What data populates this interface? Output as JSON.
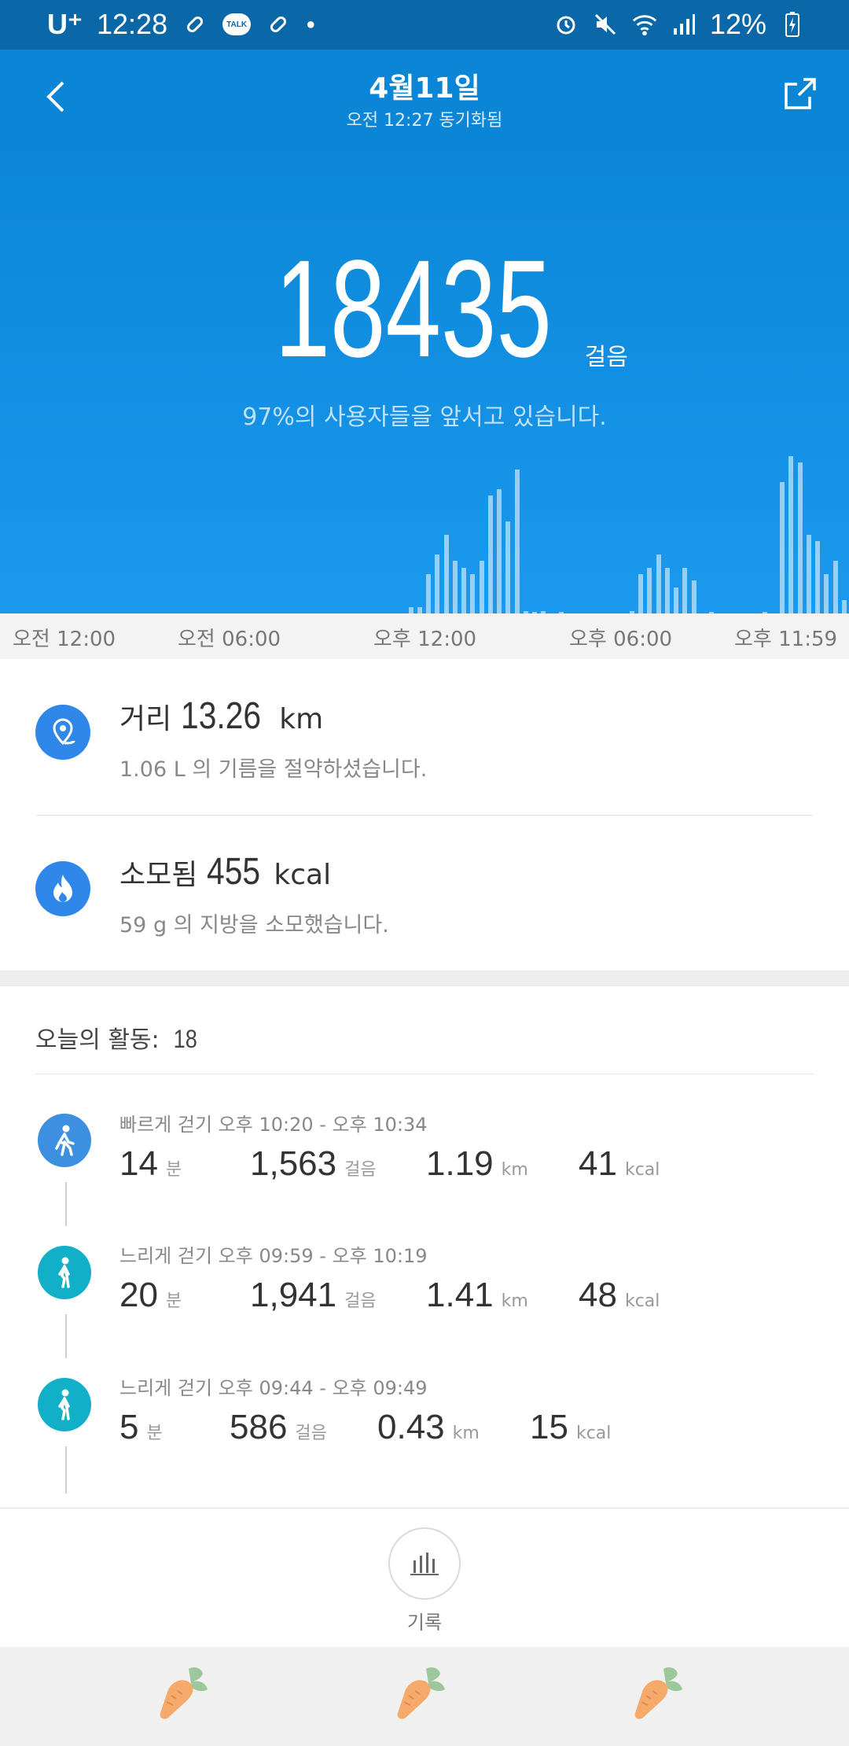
{
  "status_bar": {
    "carrier": "U⁺",
    "time": "12:28",
    "talk_badge": "TALK",
    "battery": "12%"
  },
  "header": {
    "title": "4월11일",
    "subtitle": "오전 12:27 동기화됨"
  },
  "summary": {
    "steps": "18435",
    "steps_unit": "걸음",
    "percentile_text": "97%의 사용자들을 앞서고 있습니다."
  },
  "chart_data": {
    "type": "bar",
    "x_ticks": [
      "오전 12:00",
      "오전 06:00",
      "오후 12:00",
      "오후 06:00",
      "오후 11:59"
    ],
    "bins_per_day": 96,
    "values": [
      0,
      0,
      0,
      0,
      0,
      0,
      0,
      0,
      0,
      0,
      0,
      0,
      0,
      0,
      0,
      0,
      0,
      0,
      0,
      0,
      0,
      0,
      0,
      0,
      0,
      0,
      0,
      0,
      0,
      0,
      0,
      0,
      0,
      0,
      0,
      0,
      0,
      0,
      0,
      0,
      0,
      0,
      0,
      0,
      0,
      0,
      5,
      5,
      30,
      45,
      60,
      40,
      35,
      30,
      40,
      90,
      95,
      70,
      110,
      2,
      1,
      2,
      0,
      1,
      0,
      0,
      0,
      0,
      0,
      0,
      0,
      2,
      30,
      35,
      45,
      35,
      20,
      35,
      25,
      0,
      1,
      0,
      0,
      0,
      0,
      0,
      1,
      0,
      100,
      120,
      115,
      60,
      55,
      30,
      40,
      10,
      60,
      85,
      115,
      120,
      60,
      1,
      1,
      1
    ],
    "color": "rgba(255,255,255,0.55)"
  },
  "metrics": {
    "distance": {
      "icon": "location-pin-icon",
      "label": "거리",
      "value": "13.26",
      "unit": "km",
      "note": "1.06 L 의 기름을 절약하셨습니다."
    },
    "calories": {
      "icon": "flame-icon",
      "label": "소모됨",
      "value": "455",
      "unit": "kcal",
      "note": "59 g 의 지방을 소모했습니다."
    }
  },
  "activity": {
    "title": "오늘의 활동:",
    "count": "18",
    "items": [
      {
        "type": "fast-walk",
        "label": "빠르게 걷기 오후 10:20 - 오후 10:34",
        "minutes": "14",
        "minutes_unit": "분",
        "steps": "1,563",
        "steps_unit": "걸음",
        "distance": "1.19",
        "distance_unit": "km",
        "kcal": "41",
        "kcal_unit": "kcal",
        "color": "#3d8fe0"
      },
      {
        "type": "slow-walk",
        "label": "느리게 걷기 오후 09:59 - 오후 10:19",
        "minutes": "20",
        "minutes_unit": "분",
        "steps": "1,941",
        "steps_unit": "걸음",
        "distance": "1.41",
        "distance_unit": "km",
        "kcal": "48",
        "kcal_unit": "kcal",
        "color": "#12b0c8"
      },
      {
        "type": "slow-walk",
        "label": "느리게 걷기 오후 09:44 - 오후 09:49",
        "minutes": "5",
        "minutes_unit": "분",
        "steps": "586",
        "steps_unit": "걸음",
        "distance": "0.43",
        "distance_unit": "km",
        "kcal": "15",
        "kcal_unit": "kcal",
        "color": "#12b0c8"
      }
    ]
  },
  "bottom": {
    "record_label": "기록"
  }
}
